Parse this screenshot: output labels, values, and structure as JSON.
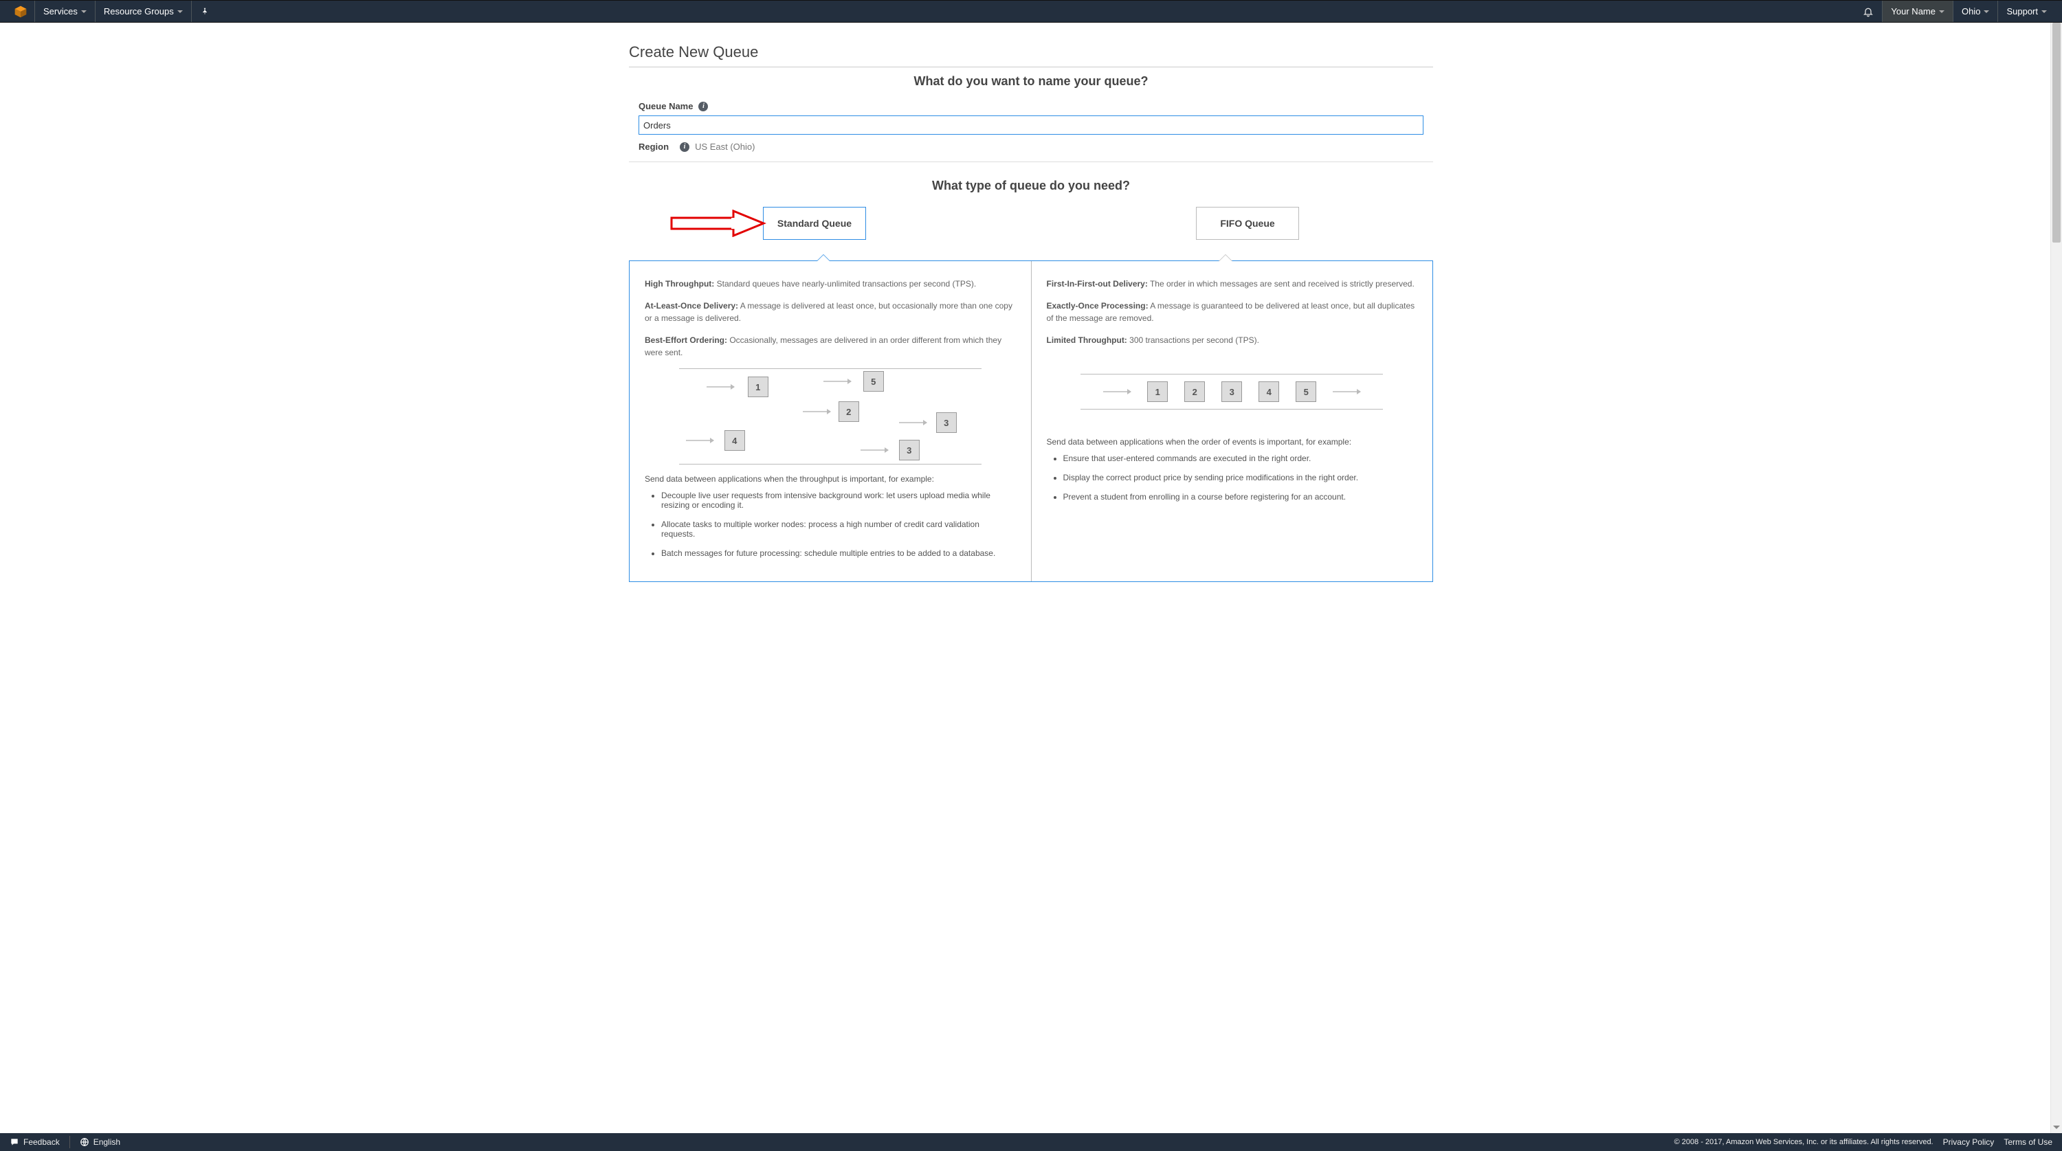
{
  "nav": {
    "services": "Services",
    "resource_groups": "Resource Groups",
    "your_name": "Your Name",
    "region": "Ohio",
    "support": "Support"
  },
  "page": {
    "title": "Create New Queue",
    "name_heading": "What do you want to name your queue?",
    "queue_name_label": "Queue Name",
    "queue_name_value": "Orders",
    "region_label": "Region",
    "region_value": "US East (Ohio)",
    "type_heading": "What type of queue do you need?"
  },
  "types": {
    "standard_label": "Standard Queue",
    "fifo_label": "FIFO Queue"
  },
  "standard": {
    "feat1_title": "High Throughput:",
    "feat1_text": " Standard queues have nearly-unlimited transactions per second (TPS).",
    "feat2_title": "At-Least-Once Delivery:",
    "feat2_text": " A message is delivered at least once, but occasionally more than one copy or a message is delivered.",
    "feat3_title": "Best-Effort Ordering:",
    "feat3_text": " Occasionally, messages are delivered in an order different from which they were sent.",
    "diagram_order": [
      "5",
      "1",
      "2",
      "3",
      "4",
      "3"
    ],
    "use_intro": "Send data between applications when the throughput is important, for example:",
    "uses": [
      "Decouple live user requests from intensive background work: let users upload media while resizing or encoding it.",
      "Allocate tasks to multiple worker nodes: process a high number of credit card validation requests.",
      "Batch messages for future processing: schedule multiple entries to be added to a database."
    ]
  },
  "fifo": {
    "feat1_title": "First-In-First-out Delivery:",
    "feat1_text": " The order in which messages are sent and received is strictly preserved.",
    "feat2_title": "Exactly-Once Processing:",
    "feat2_text": " A message is guaranteed to be delivered at least once, but all duplicates of the message are removed.",
    "feat3_title": "Limited Throughput:",
    "feat3_text": " 300 transactions per second (TPS).",
    "diagram_order": [
      "1",
      "2",
      "3",
      "4",
      "5"
    ],
    "use_intro": "Send data between applications when the order of events is important, for example:",
    "uses": [
      "Ensure that user-entered commands are executed in the right order.",
      "Display the correct product price by sending price modifications in the right order.",
      "Prevent a student from enrolling in a course before registering for an account."
    ]
  },
  "footer": {
    "feedback": "Feedback",
    "language": "English",
    "copyright": "© 2008 - 2017, Amazon Web Services, Inc. or its affiliates. All rights reserved.",
    "privacy": "Privacy Policy",
    "terms": "Terms of Use"
  }
}
